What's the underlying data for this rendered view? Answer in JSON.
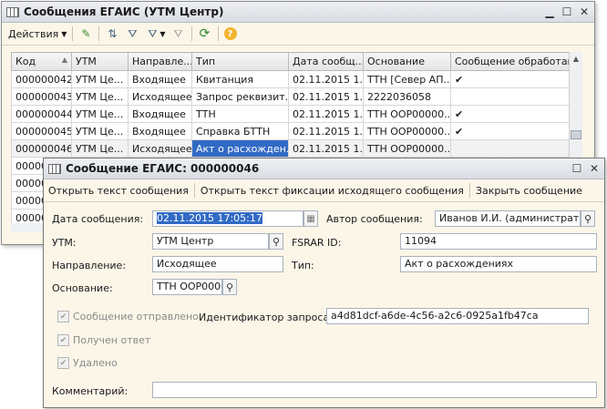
{
  "list_window": {
    "title": "Сообщения ЕГАИС (УТМ Центр)",
    "toolbar": {
      "actions_label": "Действия"
    },
    "columns": [
      "Код",
      "УТМ",
      "Направле...",
      "Тип",
      "Дата сообщ...",
      "Основание",
      "Сообщение обработано"
    ],
    "rows": [
      [
        "000000042",
        "УТМ Це...",
        "Входящее",
        "Квитанция",
        "02.11.2015 1...",
        "ТТН [Север АП...",
        "✔"
      ],
      [
        "000000043",
        "УТМ Це...",
        "Исходящее",
        "Запрос реквизит...",
        "02.11.2015 1...",
        "2222036058",
        ""
      ],
      [
        "000000044",
        "УТМ Це...",
        "Входящее",
        "ТТН",
        "02.11.2015 1...",
        "ТТН ООР00000...",
        "✔"
      ],
      [
        "000000045",
        "УТМ Це...",
        "Входящее",
        "Справка БТТН",
        "02.11.2015 1...",
        "ТТН ООР00000...",
        "✔"
      ],
      [
        "000000046",
        "УТМ Це...",
        "Исходящее",
        "Акт о расхожден...",
        "02.11.2015 1...",
        "ТТН ООР00000...",
        ""
      ],
      [
        "000000",
        "",
        "",
        "",
        "",
        "",
        ""
      ],
      [
        "000000",
        "",
        "",
        "",
        "",
        "",
        ""
      ],
      [
        "000000",
        "",
        "",
        "",
        "",
        "",
        ""
      ],
      [
        "000000",
        "",
        "",
        "",
        "",
        "",
        ""
      ]
    ]
  },
  "dialog": {
    "title": "Сообщение ЕГАИС: 000000046",
    "toolbar": {
      "open_text": "Открыть текст сообщения",
      "open_fix_text": "Открыть текст фиксации исходящего сообщения",
      "close_message": "Закрыть сообщение"
    },
    "labels": {
      "date": "Дата сообщения:",
      "author": "Автор сообщения:",
      "utm": "УТМ:",
      "fsrar": "FSRAR ID:",
      "direction": "Направление:",
      "type": "Тип:",
      "basis": "Основание:",
      "sent": "Сообщение отправлено",
      "request_id": "Идентификатор запроса:",
      "answer": "Получен ответ",
      "deleted": "Удалено",
      "comment": "Комментарий:"
    },
    "values": {
      "date": "02.11.2015 17:05:17",
      "author": "Иванов И.И. (администратор)",
      "utm": "УТМ Центр",
      "fsrar": "11094",
      "direction": "Исходящее",
      "type": "Акт о расхождениях",
      "basis": "ТТН ООР0000",
      "request_id": "a4d81dcf-a6de-4c56-a2c6-0925a1fb47ca",
      "comment": ""
    }
  }
}
